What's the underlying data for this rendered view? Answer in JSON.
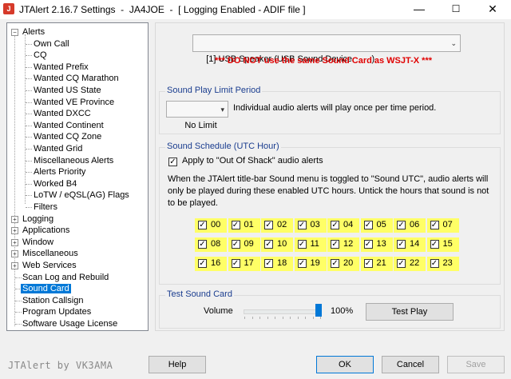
{
  "window": {
    "title": "JTAlert 2.16.7 Settings  -  JA4JOE  -  [ Logging Enabled - ADIF file ]",
    "app_icon": "J"
  },
  "tree": {
    "items": [
      {
        "label": "Alerts",
        "expander": "−"
      },
      {
        "label": "Own Call"
      },
      {
        "label": "CQ"
      },
      {
        "label": "Wanted Prefix"
      },
      {
        "label": "Wanted CQ Marathon"
      },
      {
        "label": "Wanted US State"
      },
      {
        "label": "Wanted VE Province"
      },
      {
        "label": "Wanted DXCC"
      },
      {
        "label": "Wanted Continent"
      },
      {
        "label": "Wanted CQ Zone"
      },
      {
        "label": "Wanted Grid"
      },
      {
        "label": "Miscellaneous Alerts"
      },
      {
        "label": "Alerts Priority"
      },
      {
        "label": "Worked B4"
      },
      {
        "label": "LoTW / eQSL(AG) Flags"
      },
      {
        "label": "Filters"
      },
      {
        "label": "Logging",
        "expander": "+"
      },
      {
        "label": "Applications",
        "expander": "+"
      },
      {
        "label": "Window",
        "expander": "+"
      },
      {
        "label": "Miscellaneous",
        "expander": "+"
      },
      {
        "label": "Web Services",
        "expander": "+"
      },
      {
        "label": "Scan Log and Rebuild"
      },
      {
        "label": "Sound Card"
      },
      {
        "label": "Station Callsign"
      },
      {
        "label": "Program Updates"
      },
      {
        "label": "Software Usage License"
      }
    ]
  },
  "sound_card": {
    "device": "[1] USB Speaker (USB Sound Device        )",
    "warning": "*** DO NOT use the same Sound Card as WSJT-X ***"
  },
  "play_limit": {
    "group_title": "Sound Play Limit Period",
    "value": "No Limit",
    "description": "Individual audio alerts will play once per time period."
  },
  "schedule": {
    "group_title": "Sound Schedule (UTC Hour)",
    "apply_label": "Apply to \"Out Of Shack\" audio alerts",
    "apply_checked": "✓",
    "description": "When the JTAlert title-bar Sound menu is toggled to \"Sound UTC\", audio alerts will only be played during these enabled UTC hours. Untick the hours that sound is not to be played.",
    "check_mark": "✓",
    "hours": [
      "00",
      "01",
      "02",
      "03",
      "04",
      "05",
      "06",
      "07",
      "08",
      "09",
      "10",
      "11",
      "12",
      "13",
      "14",
      "15",
      "16",
      "17",
      "18",
      "19",
      "20",
      "21",
      "22",
      "23"
    ]
  },
  "test": {
    "group_title": "Test Sound Card",
    "volume_label": "Volume",
    "volume_value": "100%",
    "volume_fraction": 1.0,
    "test_button": "Test Play"
  },
  "footer": {
    "brand": "JTAlert by VK3AMA",
    "help": "Help",
    "ok": "OK",
    "cancel": "Cancel",
    "save": "Save"
  },
  "icons": {
    "minimize": "—",
    "maximize": "☐",
    "close": "✕",
    "dropdown": "⌄",
    "combo_arrow": "▾"
  },
  "colors": {
    "selection": "#0078d7",
    "warning": "#e00000",
    "hour_bg": "#ffff66",
    "group_title": "#1a3d8f"
  }
}
